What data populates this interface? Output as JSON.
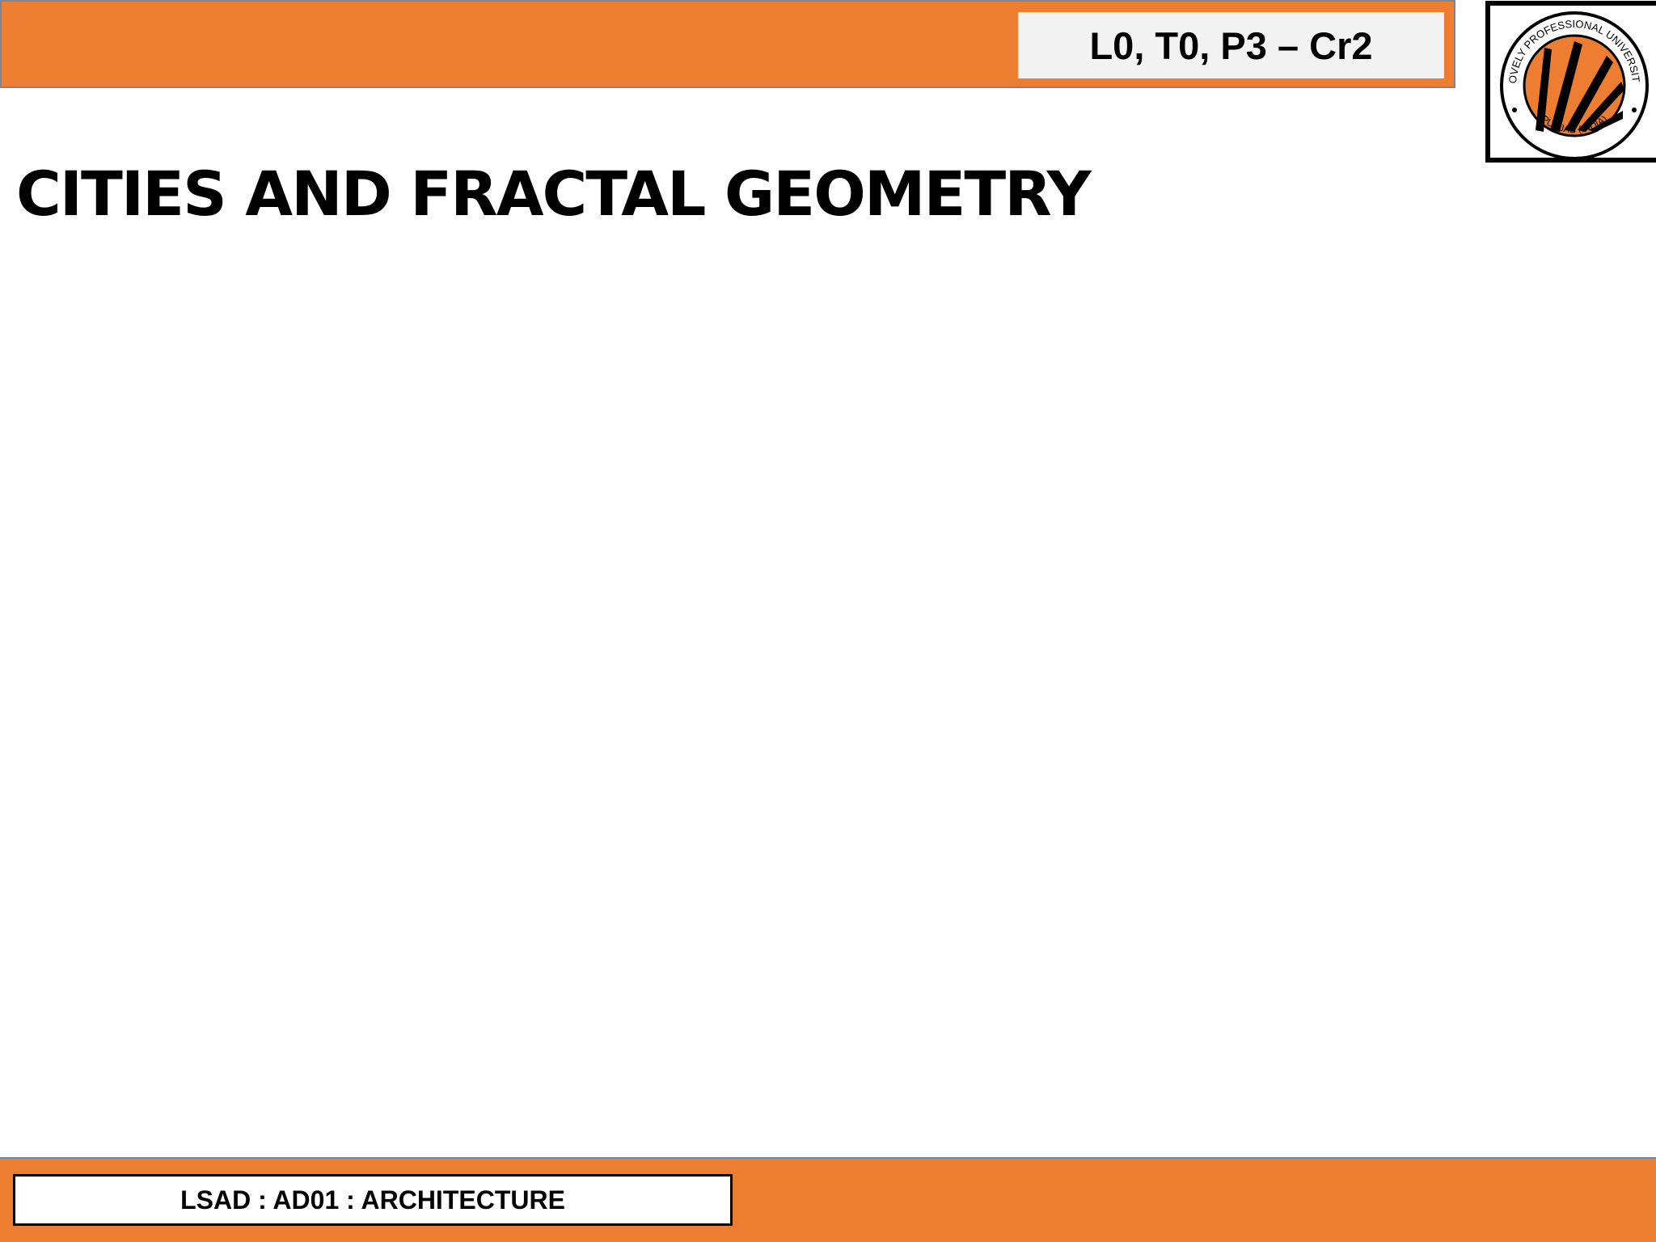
{
  "header": {
    "credits": "L0, T0, P3 – Cr2",
    "logo": {
      "icon": "university-seal-icon",
      "text_top": "LOVELY PROFESSIONAL UNIVERSITY",
      "text_bottom": "PUNJAB (INDIA)"
    }
  },
  "slide": {
    "title": "CITIES AND FRACTAL GEOMETRY"
  },
  "footer": {
    "course": "LSAD : AD01 : ARCHITECTURE"
  },
  "colors": {
    "accent": "#ED7D31",
    "credit_box": "#F2F2F2",
    "text": "#000000"
  }
}
